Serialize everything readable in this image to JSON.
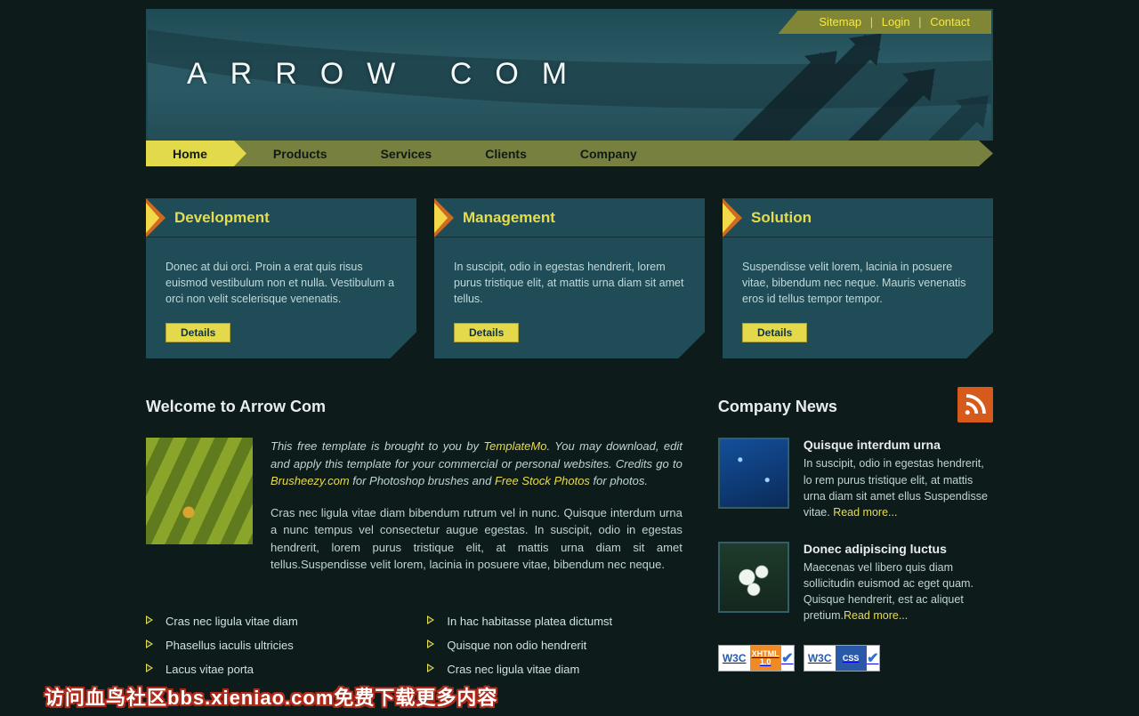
{
  "topnav": [
    "Sitemap",
    "Login",
    "Contact"
  ],
  "site_title": "ARROW COM",
  "menu": [
    "Home",
    "Products",
    "Services",
    "Clients",
    "Company"
  ],
  "features": [
    {
      "title": "Development",
      "text": "Donec at dui orci. Proin a erat quis risus euismod vestibulum non et nulla. Vestibulum a orci non velit scelerisque venenatis.",
      "button": "Details"
    },
    {
      "title": "Management",
      "text": "In suscipit, odio in egestas hendrerit, lorem purus tristique elit, at mattis urna diam sit amet tellus.",
      "button": "Details"
    },
    {
      "title": "Solution",
      "text": "Suspendisse velit lorem, lacinia in posuere vitae, bibendum nec neque. Mauris venenatis eros id tellus tempor tempor.",
      "button": "Details"
    }
  ],
  "welcome": {
    "heading": "Welcome to Arrow Com",
    "p1a": "This free template is brought to you by ",
    "p1_link1": "TemplateMo",
    "p1b": ". You may download, edit and apply this template for your commercial or personal websites. Credits go to ",
    "p1_link2": "Brusheezy.com",
    "p1c": " for Photoshop brushes and ",
    "p1_link3": "Free Stock Photos",
    "p1d": " for photos.",
    "p2": "Cras nec ligula vitae diam bibendum rutrum vel in nunc. Quisque interdum urna a nunc tempus vel consectetur augue egestas. In suscipit, odio in egestas hendrerit, lorem purus tristique elit, at mattis urna diam sit amet tellus.Suspendisse velit lorem, lacinia in posuere vitae, bibendum nec neque.",
    "links_col1": [
      "Cras nec ligula vitae diam",
      "Phasellus iaculis ultricies",
      "Lacus vitae porta"
    ],
    "links_col2": [
      "In hac habitasse platea dictumst",
      "Quisque non odio hendrerit",
      "Cras nec ligula vitae diam"
    ]
  },
  "news": {
    "heading": "Company News",
    "items": [
      {
        "title": "Quisque interdum urna",
        "text": "In suscipit, odio in egestas hendrerit, lo rem purus tristique elit, at mattis urna diam sit amet ellus Suspendisse vitae. ",
        "more": "Read more..."
      },
      {
        "title": "Donec adipiscing luctus",
        "text": "Maecenas vel libero quis diam sollicitudin euismod ac eget quam. Quisque hendrerit, est ac aliquet pretium.",
        "more": "Read more..."
      }
    ]
  },
  "badges": {
    "xhtml": "XHTML",
    "xhtml_v": "1.0",
    "css": "CSS",
    "w3c": "W3C"
  },
  "banner": "访问血鸟社区bbs.xieniao.com免费下载更多内容"
}
